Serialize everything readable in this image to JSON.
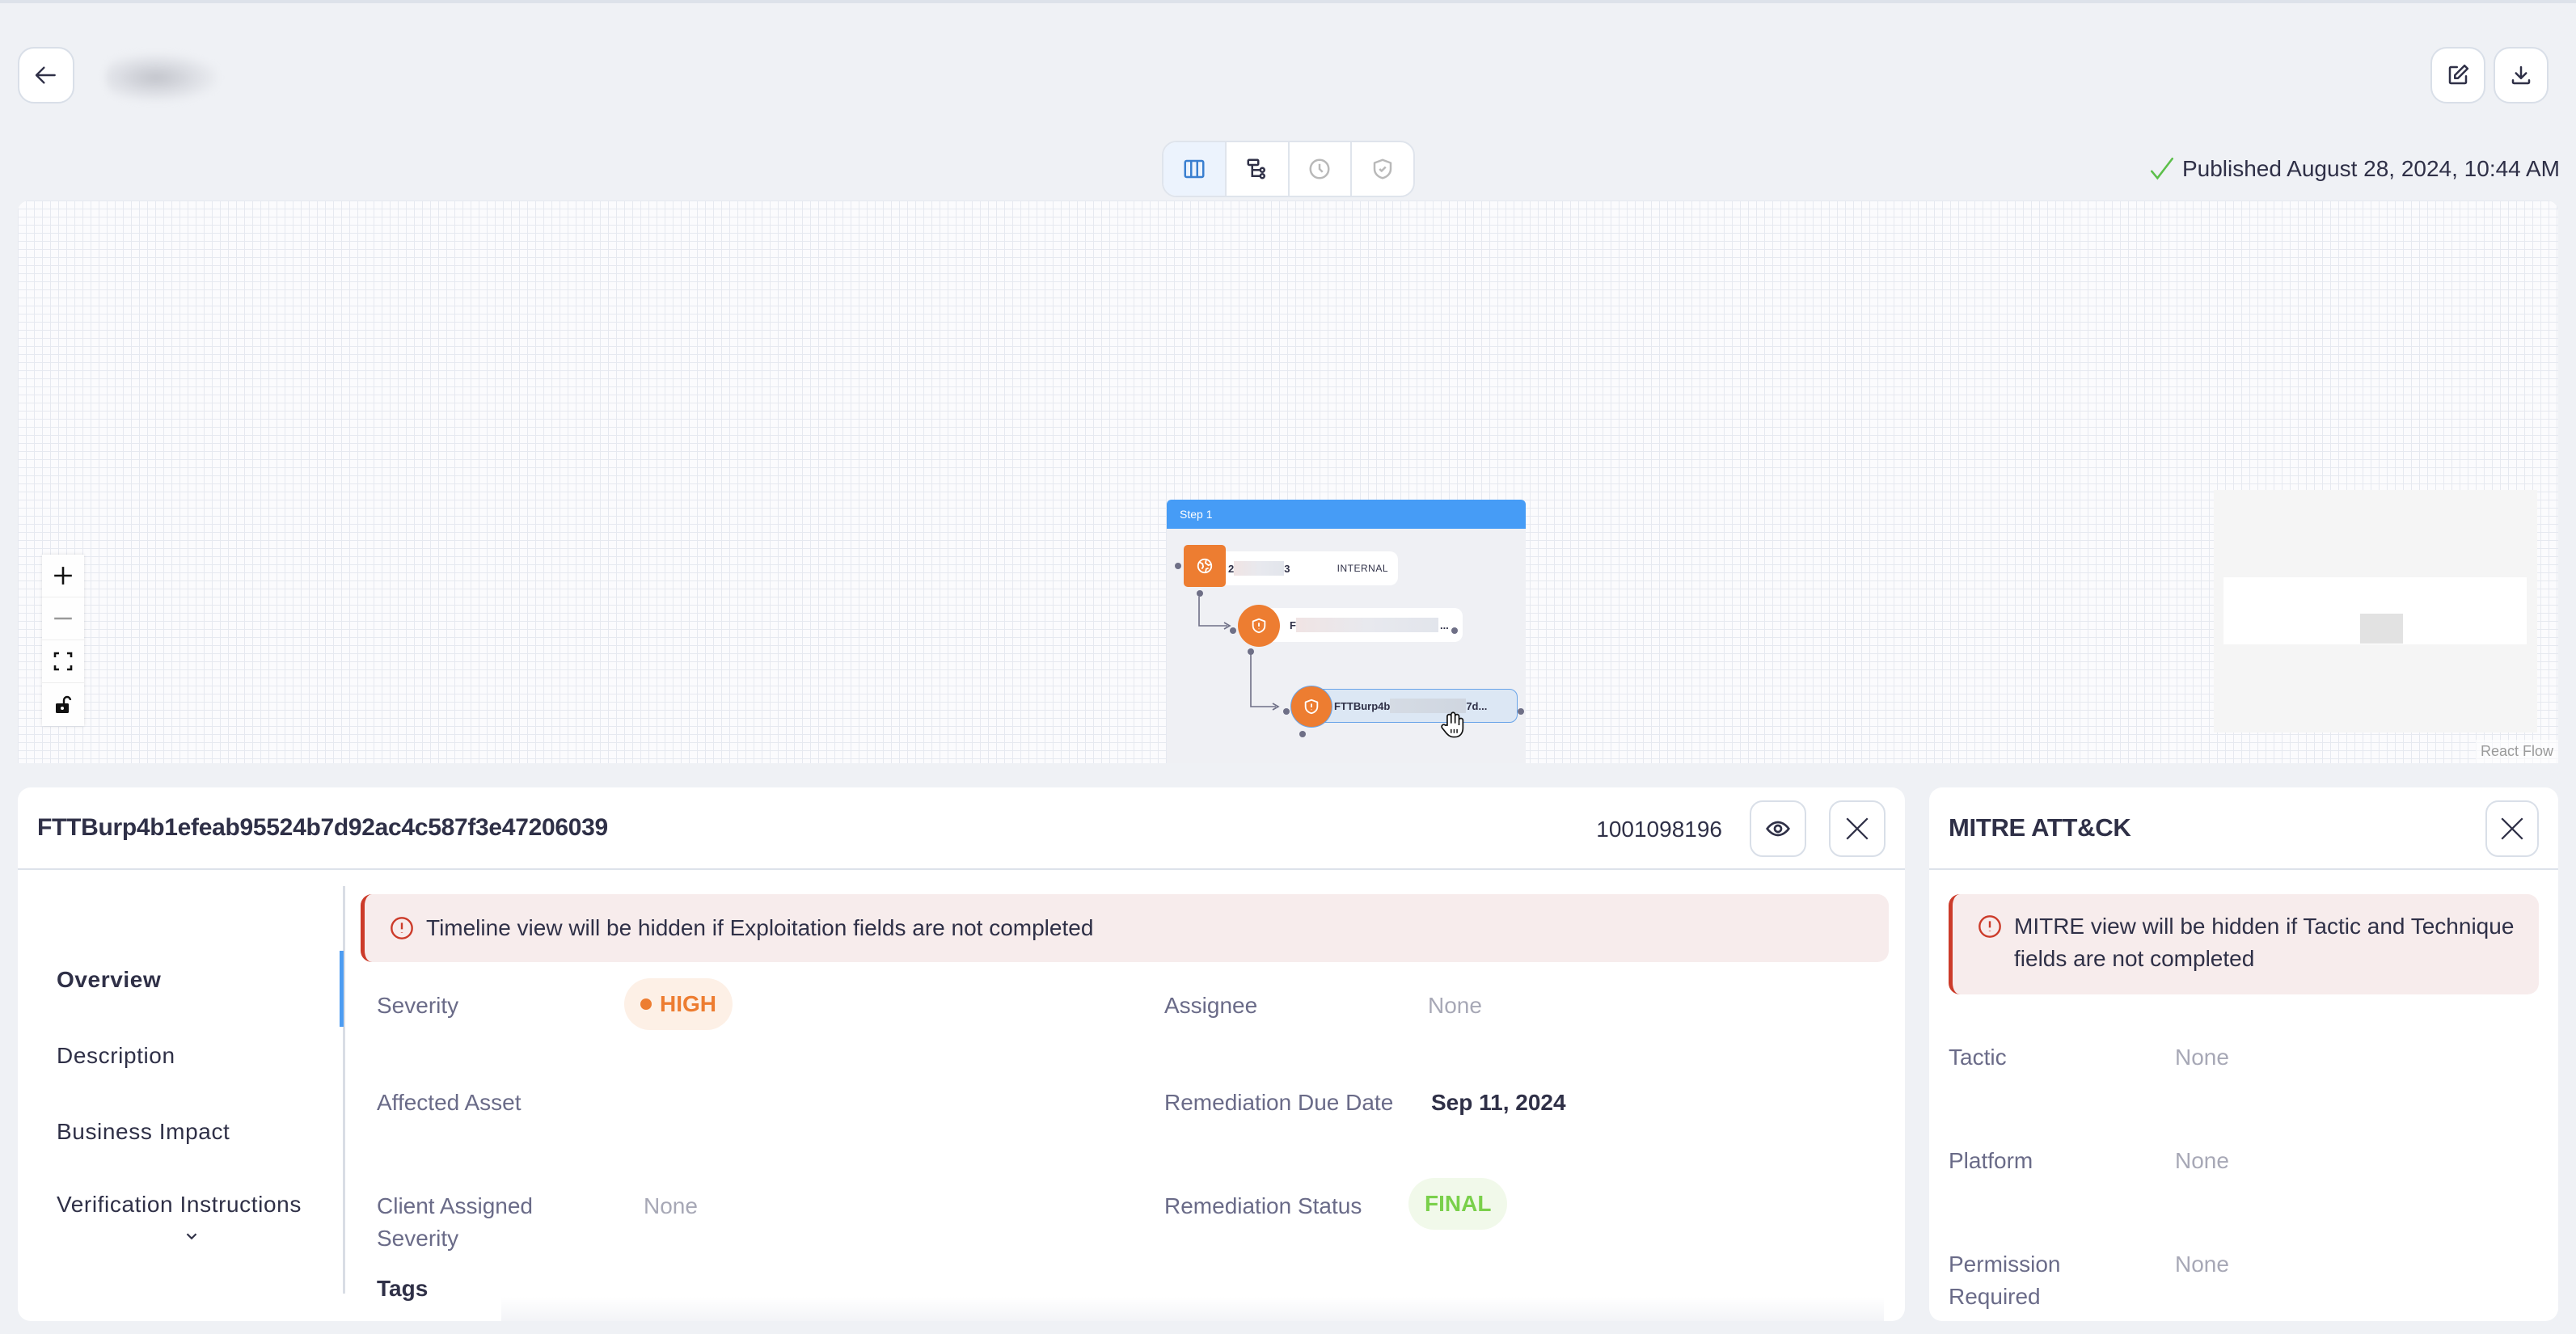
{
  "header": {
    "back_icon": "arrow-left-icon",
    "title_redacted": true,
    "edit_icon": "edit-icon",
    "download_icon": "download-icon",
    "published_text": "Published August 28, 2024, 10:44 AM",
    "published_icon": "checkmark-icon",
    "accent_success": "#5cbf4a"
  },
  "view_switcher": {
    "options": [
      {
        "name": "columns-view",
        "icon": "columns-icon",
        "active": true
      },
      {
        "name": "tree-view",
        "icon": "hierarchy-icon",
        "active": false
      },
      {
        "name": "timeline-view",
        "icon": "clock-icon",
        "active": false,
        "disabled": true
      },
      {
        "name": "mitre-view",
        "icon": "shield-check-icon",
        "active": false,
        "disabled": true
      }
    ]
  },
  "canvas": {
    "zoom_controls": [
      "zoom-in",
      "zoom-out",
      "fit-view",
      "toggle-lock"
    ],
    "step_group": {
      "label": "Step 1",
      "nodes": [
        {
          "type": "asset",
          "icon": "globe-icon",
          "label_prefix": "2",
          "label_suffix": "3",
          "tag": "INTERNAL"
        },
        {
          "type": "finding",
          "icon": "shield-alert-icon",
          "label_prefix": "F",
          "label_suffix": "..."
        },
        {
          "type": "finding",
          "icon": "shield-alert-icon",
          "label_prefix": "FTTBurp4b",
          "label_suffix": "7d...",
          "selected": true
        }
      ]
    },
    "attribution": "React Flow",
    "accent_node": "#ed7d31",
    "accent_step": "#469cf6"
  },
  "detail_panel": {
    "title": "FTTBurp4b1efeab95524b7d92ac4c587f3e47206039",
    "finding_number": "1001098196",
    "view_icon": "eye-icon",
    "close_icon": "close-icon",
    "nav": [
      {
        "label": "Overview",
        "active": true
      },
      {
        "label": "Description",
        "active": false
      },
      {
        "label": "Business Impact",
        "active": false
      },
      {
        "label": "Verification Instructions",
        "active": false
      }
    ],
    "nav_more_icon": "chevron-down-icon",
    "alert": "Timeline view will be hidden if Exploitation fields are not completed",
    "fields": {
      "severity": {
        "label": "Severity",
        "value": "HIGH",
        "color": "#ed7d31"
      },
      "assignee": {
        "label": "Assignee",
        "value": "None"
      },
      "affected_asset": {
        "label": "Affected Asset",
        "value": ""
      },
      "remediation_due_date": {
        "label": "Remediation Due Date",
        "value": "Sep 11, 2024"
      },
      "client_assigned_severity": {
        "label": "Client Assigned Severity",
        "value": "None"
      },
      "remediation_status": {
        "label": "Remediation Status",
        "value": "FINAL",
        "color": "#7ad04b"
      }
    },
    "tags_heading": "Tags"
  },
  "mitre_panel": {
    "title": "MITRE ATT&CK",
    "close_icon": "close-icon",
    "alert": "MITRE view will be hidden if Tactic and Technique fields are not completed",
    "fields": {
      "tactic": {
        "label": "Tactic",
        "value": "None"
      },
      "platform": {
        "label": "Platform",
        "value": "None"
      },
      "permission_required": {
        "label": "Permission Required",
        "value": "None"
      }
    }
  },
  "alert_color": "#cc3b2a"
}
